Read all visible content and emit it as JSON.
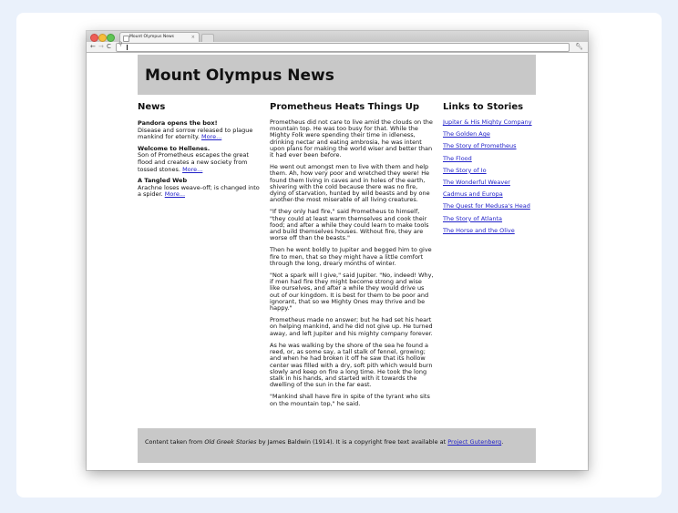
{
  "browser": {
    "tab_title": "Mount Olympus News",
    "tab_close": "×",
    "address_value": ""
  },
  "page": {
    "site_title": "Mount Olympus News",
    "news": {
      "heading": "News",
      "items": [
        {
          "title": "Pandora opens the box!",
          "body": "Disease and sorrow released to plague mankind for eternity.",
          "more": "More..."
        },
        {
          "title": "Welcome to Hellenes.",
          "body": "Son of Prometheus escapes the great flood and creates a new society from tossed stones.",
          "more": "More..."
        },
        {
          "title": "A Tangled Web",
          "body": "Arachne loses weave-off; is changed into a spider.",
          "more": "More..."
        }
      ]
    },
    "article": {
      "heading": "Prometheus Heats Things Up",
      "paragraphs": [
        "Prometheus did not care to live amid the clouds on the mountain top. He was too busy for that. While the Mighty Folk were spending their time in idleness, drinking nectar and eating ambrosia, he was intent upon plans for making the world wiser and better than it had ever been before.",
        "He went out amongst men to live with them and help them. Ah, how very poor and wretched they were! He found them living in caves and in holes of the earth, shivering with the cold because there was no fire, dying of starvation, hunted by wild beasts and by one another-the most miserable of all living creatures.",
        "\"If they only had fire,\" said Prometheus to himself, \"they could at least warm themselves and cook their food; and after a while they could learn to make tools and build themselves houses. Without fire, they are worse off than the beasts.\"",
        "Then he went boldly to Jupiter and begged him to give fire to men, that so they might have a little comfort through the long, dreary months of winter.",
        "\"Not a spark will I give,\" said Jupiter. \"No, indeed! Why, if men had fire they might become strong and wise like ourselves, and after a while they would drive us out of our kingdom. It is best for them to be poor and ignorant, that so we Mighty Ones may thrive and be happy.\"",
        "Prometheus made no answer; but he had set his heart on helping mankind, and he did not give up. He turned away, and left Jupiter and his mighty company forever.",
        "As he was walking by the shore of the sea he found a reed, or, as some say, a tall stalk of fennel, growing; and when he had broken it off he saw that its hollow center was filled with a dry, soft pith which would burn slowly and keep on fire a long time. He took the long stalk in his hands, and started with it towards the dwelling of the sun in the far east.",
        "\"Mankind shall have fire in spite of the tyrant who sits on the mountain top,\" he said."
      ]
    },
    "links": {
      "heading": "Links to Stories",
      "items": [
        "Jupiter & His Mighty Company",
        "The Golden Age",
        "The Story of Prometheus",
        "The Flood",
        "The Story of Io",
        "The Wonderful Weaver",
        "Cadmus and Europa",
        "The Quest for Medusa's Head",
        "The Story of Atlanta",
        "The Horse and the Olive"
      ]
    },
    "footer": {
      "prefix": "Content taken from ",
      "book_title": "Old Greek Stories",
      "middle": " by James Baldwin (1914). It is a copyright free text available at ",
      "link_text": "Project Gutenberg",
      "suffix": "."
    }
  },
  "colors": {
    "header_bg": "#c8c8c8",
    "link": "#2121c8",
    "background": "#eaf1fb"
  }
}
